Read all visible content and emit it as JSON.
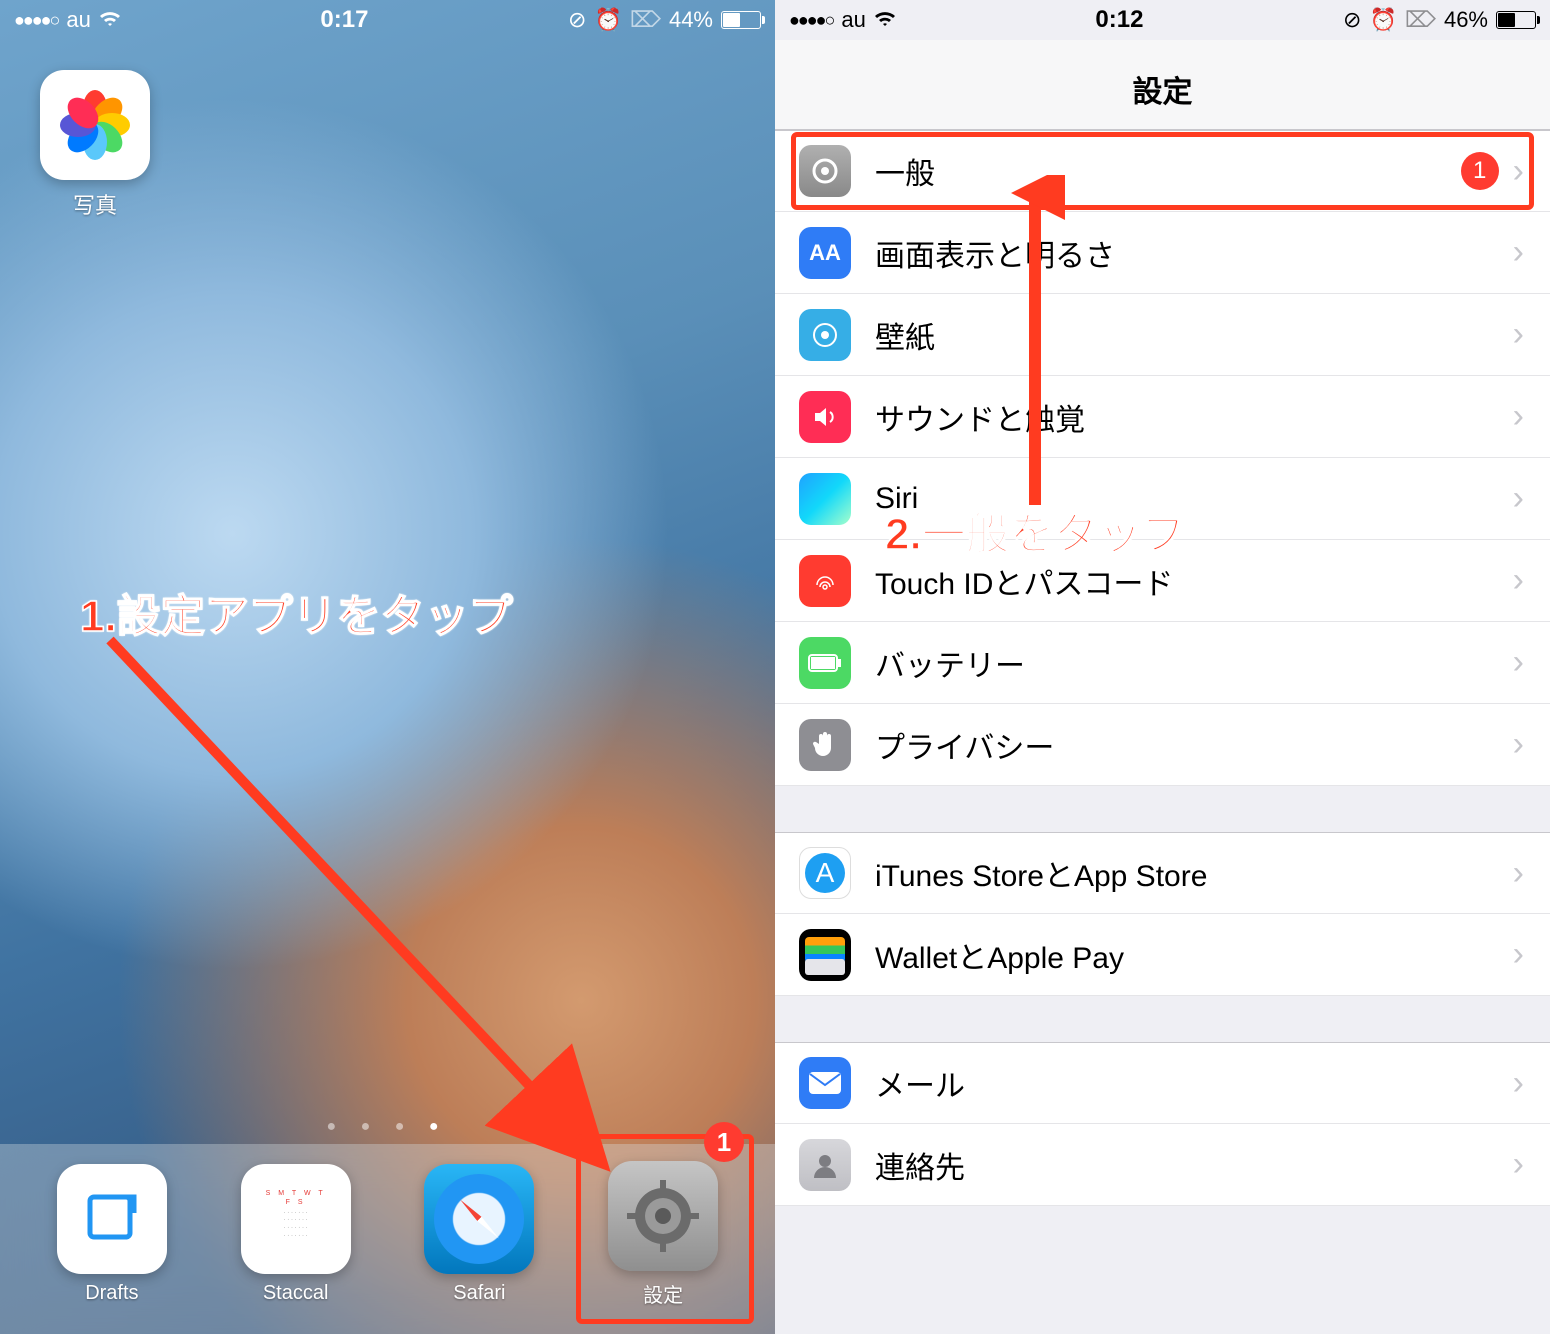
{
  "left": {
    "status": {
      "carrier": "au",
      "signal": "●●●●○",
      "time": "0:17",
      "battery_pct": "44%",
      "battery_fill": 44
    },
    "apps": {
      "photos_label": "写真"
    },
    "dock": [
      {
        "label": "Drafts"
      },
      {
        "label": "Staccal"
      },
      {
        "label": "Safari"
      },
      {
        "label": "設定"
      }
    ],
    "annotation": {
      "text": "1.設定アプリをタップ",
      "badge": "1"
    }
  },
  "right": {
    "status": {
      "carrier": "au",
      "signal": "●●●●○",
      "time": "0:12",
      "battery_pct": "46%",
      "battery_fill": 46
    },
    "nav_title": "設定",
    "group1": [
      {
        "label": "一般",
        "badge": "1",
        "icon": "general"
      },
      {
        "label": "画面表示と明るさ",
        "icon": "display"
      },
      {
        "label": "壁紙",
        "icon": "wallpaper"
      },
      {
        "label": "サウンドと触覚",
        "icon": "sound"
      },
      {
        "label": "Siri",
        "icon": "siri"
      },
      {
        "label": "Touch IDとパスコード",
        "icon": "touchid"
      },
      {
        "label": "バッテリー",
        "icon": "battery"
      },
      {
        "label": "プライバシー",
        "icon": "privacy"
      }
    ],
    "group2": [
      {
        "label": "iTunes StoreとApp Store",
        "icon": "itunes"
      },
      {
        "label": "WalletとApple Pay",
        "icon": "wallet"
      }
    ],
    "group3": [
      {
        "label": "メール",
        "icon": "mail"
      },
      {
        "label": "連絡先",
        "icon": "contacts"
      }
    ],
    "annotation": {
      "text": "2.一般をタップ",
      "badge": "1"
    }
  }
}
